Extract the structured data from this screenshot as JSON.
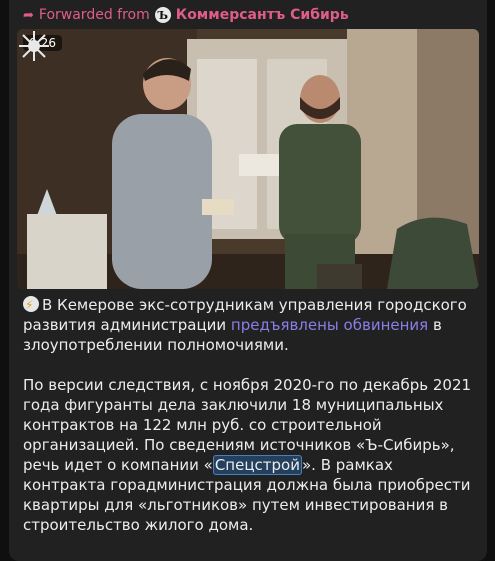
{
  "forward": {
    "prefix": "Forwarded from",
    "channel": "Коммерсантъ Сибирь",
    "channel_logo": "Ъ"
  },
  "video": {
    "duration": "0:26"
  },
  "message": {
    "p1_before": "В Кемерове экс-сотрудникам управления городского развития администрации ",
    "p1_link": "предъявлены обвинения",
    "p1_after": " в злоупотреблении полномочиями.",
    "p2_before": "По версии следствия, с ноября 2020-го по декабрь 2021 года фигуранты дела заключили 18 муниципальных контрактов на 122 млн руб. со строительной организацией. По сведениям источников «Ъ-Сибирь», речь идет о компании «",
    "p2_highlight": "Спецстрой",
    "p2_after": "». В рамках контракта горадминистрация должна была приобрести квартиры для «льготников» путем инвестирования в строительство жилого дома."
  },
  "icons": {
    "forward": "forward-arrow-icon",
    "lightning": "lightning-emoji-icon",
    "emblem": "investigative-committee-emblem-icon"
  },
  "colors": {
    "accent": "#e05d8a",
    "link": "#8a7ee8",
    "bubble": "#212121"
  }
}
